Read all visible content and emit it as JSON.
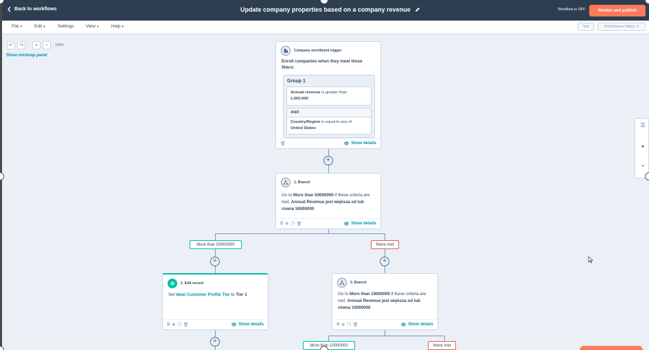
{
  "topbar": {
    "back_label": "Back to workflows",
    "title": "Update company properties based on a company revenue",
    "status": "Workflow is OFF",
    "publish_label": "Review and publish"
  },
  "menubar": {
    "file": "File",
    "edit": "Edit",
    "settings": "Settings",
    "view": "View",
    "help": "Help",
    "test": "Test",
    "performance": "Performance history"
  },
  "zoom": {
    "percent": "100%",
    "minimap": "Show minimap panel"
  },
  "trigger": {
    "title": "Company enrollment trigger",
    "intro": "Enroll companies when they meet these filters:",
    "group_title": "Group 1",
    "filter1_prop": "Annual revenue",
    "filter1_op": "is greater than",
    "filter1_value": "1,000,000",
    "and_label": "AND",
    "filter2_prop": "Country/Region",
    "filter2_op": "is equal to any of",
    "filter2_value": "United States",
    "show_details": "Show details"
  },
  "branch1": {
    "title": "1. Branch",
    "pre": "Go to",
    "target": "More than 50000000",
    "mid": "if these criteria are met:",
    "criteria": "Annual Revenue jest większa od lub równa 50000000",
    "show_details": "Show details",
    "label_left": "More than 50000000",
    "label_right": "None met"
  },
  "edit_record": {
    "title": "2. Edit record",
    "set": "Set",
    "property": "Ideal Customer Profile Tier",
    "to": "to",
    "value": "Tier 1",
    "show_details": "Show details"
  },
  "branch3": {
    "title": "3. Branch",
    "pre": "Go to",
    "target": "More than 10000000",
    "mid": "if these criteria are met:",
    "criteria": "Annual Revenue jest większa od lub równa 10000000",
    "show_details": "Show details",
    "label_left": "More than 10000000",
    "label_right": "None met"
  },
  "colors": {
    "topbar": "#2d3e50",
    "accent": "#ff7a59",
    "link": "#0091ae",
    "teal": "#00bda5",
    "none_met": "#f2545b"
  }
}
